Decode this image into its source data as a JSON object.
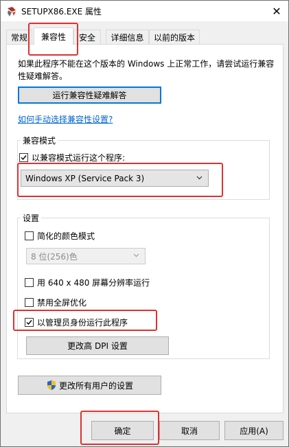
{
  "window": {
    "title": "SETUPX86.EXE 属性",
    "close_glyph": "✕"
  },
  "tabs": [
    {
      "label": "常规",
      "active": false
    },
    {
      "label": "兼容性",
      "active": true
    },
    {
      "label": "安全",
      "active": false
    },
    {
      "label": "详细信息",
      "active": false
    },
    {
      "label": "以前的版本",
      "active": false
    }
  ],
  "panel": {
    "intro": "如果此程序不能在这个版本的 Windows 上正常工作，请尝试运行兼容性疑难解答。",
    "troubleshoot_button": "运行兼容性疑难解答",
    "manual_link": "如何手动选择兼容性设置?",
    "compat_mode": {
      "group_label": "兼容模式",
      "run_in_compat_label": "以兼容模式运行这个程序:",
      "run_in_compat_checked": true,
      "os_selected": "Windows XP (Service Pack 3)"
    },
    "settings": {
      "group_label": "设置",
      "reduced_color_label": "简化的颜色模式",
      "reduced_color_checked": false,
      "color_depth_selected": "8 位(256)色",
      "res_640_label": "用 640 x 480 屏幕分辨率运行",
      "res_640_checked": false,
      "disable_fullscreen_label": "禁用全屏优化",
      "disable_fullscreen_checked": false,
      "run_as_admin_label": "以管理员身份运行此程序",
      "run_as_admin_checked": true,
      "high_dpi_button": "更改高 DPI 设置"
    },
    "all_users_button": "更改所有用户的设置"
  },
  "footer": {
    "ok": "确定",
    "cancel": "取消",
    "apply": "应用(A)"
  },
  "colors": {
    "callout": "#e03030",
    "link": "#0066cc",
    "focus": "#0078d7"
  }
}
